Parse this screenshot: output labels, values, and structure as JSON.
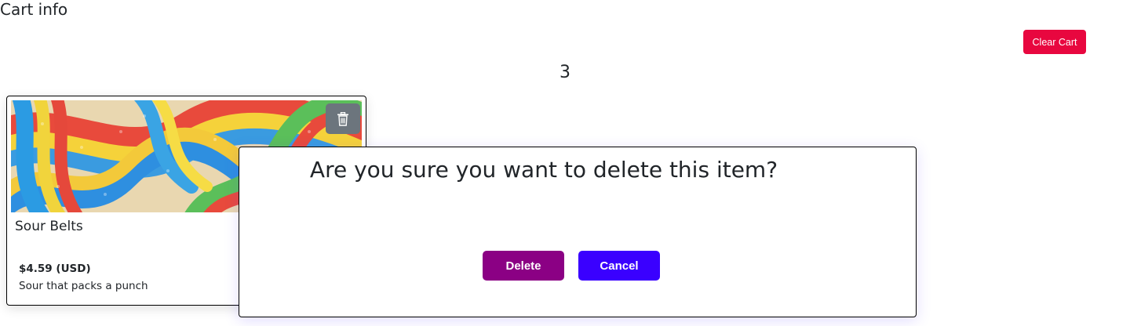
{
  "page": {
    "title": "Cart info"
  },
  "toolbar": {
    "clear_cart_label": "Clear Cart"
  },
  "cart": {
    "count": "3"
  },
  "item": {
    "name": "Sour Belts",
    "price": "$4.59 (USD)",
    "description": "Sour that packs a punch",
    "delete_icon": "trash-icon",
    "image": "sour-belts-candy-photo"
  },
  "dialog": {
    "question": "Are you sure you want to delete this item?",
    "delete_label": "Delete",
    "cancel_label": "Cancel"
  },
  "colors": {
    "clear_cart": "#e8073f",
    "delete": "#8b0084",
    "cancel": "#3a00ff",
    "trash_button": "#6c757d"
  }
}
